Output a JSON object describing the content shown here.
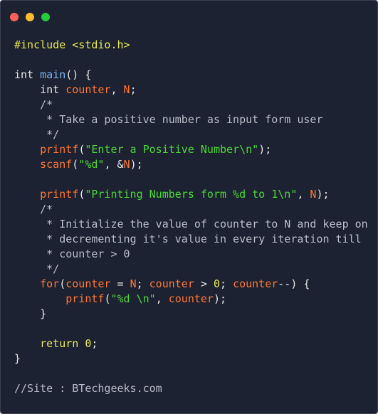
{
  "window": {
    "buttons": [
      "close",
      "minimize",
      "maximize"
    ],
    "colors": {
      "background": "#1d2232",
      "close": "#ff5f56",
      "minimize": "#ffbd2e",
      "maximize": "#27c93f"
    }
  },
  "code": {
    "language": "c",
    "lines": [
      [
        {
          "t": "#include <stdio.h>",
          "c": "directive"
        }
      ],
      [],
      [
        {
          "t": "int ",
          "c": "type"
        },
        {
          "t": "main",
          "c": "func"
        },
        {
          "t": "() {",
          "c": "plain"
        }
      ],
      [
        {
          "t": "    int ",
          "c": "type"
        },
        {
          "t": "counter",
          "c": "var"
        },
        {
          "t": ", ",
          "c": "plain"
        },
        {
          "t": "N",
          "c": "var"
        },
        {
          "t": ";",
          "c": "plain"
        }
      ],
      [
        {
          "t": "    /*",
          "c": "comment"
        }
      ],
      [
        {
          "t": "     * Take a positive number as input form user",
          "c": "comment"
        }
      ],
      [
        {
          "t": "     */",
          "c": "comment"
        }
      ],
      [
        {
          "t": "    ",
          "c": "plain"
        },
        {
          "t": "printf",
          "c": "call"
        },
        {
          "t": "(",
          "c": "plain"
        },
        {
          "t": "\"Enter a Positive Number\\n\"",
          "c": "str"
        },
        {
          "t": ");",
          "c": "plain"
        }
      ],
      [
        {
          "t": "    ",
          "c": "plain"
        },
        {
          "t": "scanf",
          "c": "call"
        },
        {
          "t": "(",
          "c": "plain"
        },
        {
          "t": "\"%d\"",
          "c": "str"
        },
        {
          "t": ", &",
          "c": "plain"
        },
        {
          "t": "N",
          "c": "var"
        },
        {
          "t": ");",
          "c": "plain"
        }
      ],
      [],
      [
        {
          "t": "    ",
          "c": "plain"
        },
        {
          "t": "printf",
          "c": "call"
        },
        {
          "t": "(",
          "c": "plain"
        },
        {
          "t": "\"Printing Numbers form %d to 1\\n\"",
          "c": "str"
        },
        {
          "t": ", ",
          "c": "plain"
        },
        {
          "t": "N",
          "c": "var"
        },
        {
          "t": ");",
          "c": "plain"
        }
      ],
      [
        {
          "t": "    /*",
          "c": "comment"
        }
      ],
      [
        {
          "t": "     * Initialize the value of counter to N and keep on",
          "c": "comment"
        }
      ],
      [
        {
          "t": "     * decrementing it's value in every iteration till",
          "c": "comment"
        }
      ],
      [
        {
          "t": "     * counter > 0",
          "c": "comment"
        }
      ],
      [
        {
          "t": "     */",
          "c": "comment"
        }
      ],
      [
        {
          "t": "    ",
          "c": "plain"
        },
        {
          "t": "for",
          "c": "call"
        },
        {
          "t": "(",
          "c": "plain"
        },
        {
          "t": "counter",
          "c": "var"
        },
        {
          "t": " = ",
          "c": "plain"
        },
        {
          "t": "N",
          "c": "var"
        },
        {
          "t": "; ",
          "c": "plain"
        },
        {
          "t": "counter",
          "c": "var"
        },
        {
          "t": " > ",
          "c": "plain"
        },
        {
          "t": "0",
          "c": "num"
        },
        {
          "t": "; ",
          "c": "plain"
        },
        {
          "t": "counter",
          "c": "var"
        },
        {
          "t": "--) {",
          "c": "plain"
        }
      ],
      [
        {
          "t": "        ",
          "c": "plain"
        },
        {
          "t": "printf",
          "c": "call"
        },
        {
          "t": "(",
          "c": "plain"
        },
        {
          "t": "\"%d \\n\"",
          "c": "str"
        },
        {
          "t": ", ",
          "c": "plain"
        },
        {
          "t": "counter",
          "c": "var"
        },
        {
          "t": ");",
          "c": "plain"
        }
      ],
      [
        {
          "t": "    }",
          "c": "plain"
        }
      ],
      [],
      [
        {
          "t": "    return ",
          "c": "kw"
        },
        {
          "t": "0",
          "c": "num"
        },
        {
          "t": ";",
          "c": "plain"
        }
      ],
      [
        {
          "t": "}",
          "c": "plain"
        }
      ],
      [],
      [
        {
          "t": "//Site : BTechgeeks.com",
          "c": "comment"
        }
      ]
    ]
  }
}
